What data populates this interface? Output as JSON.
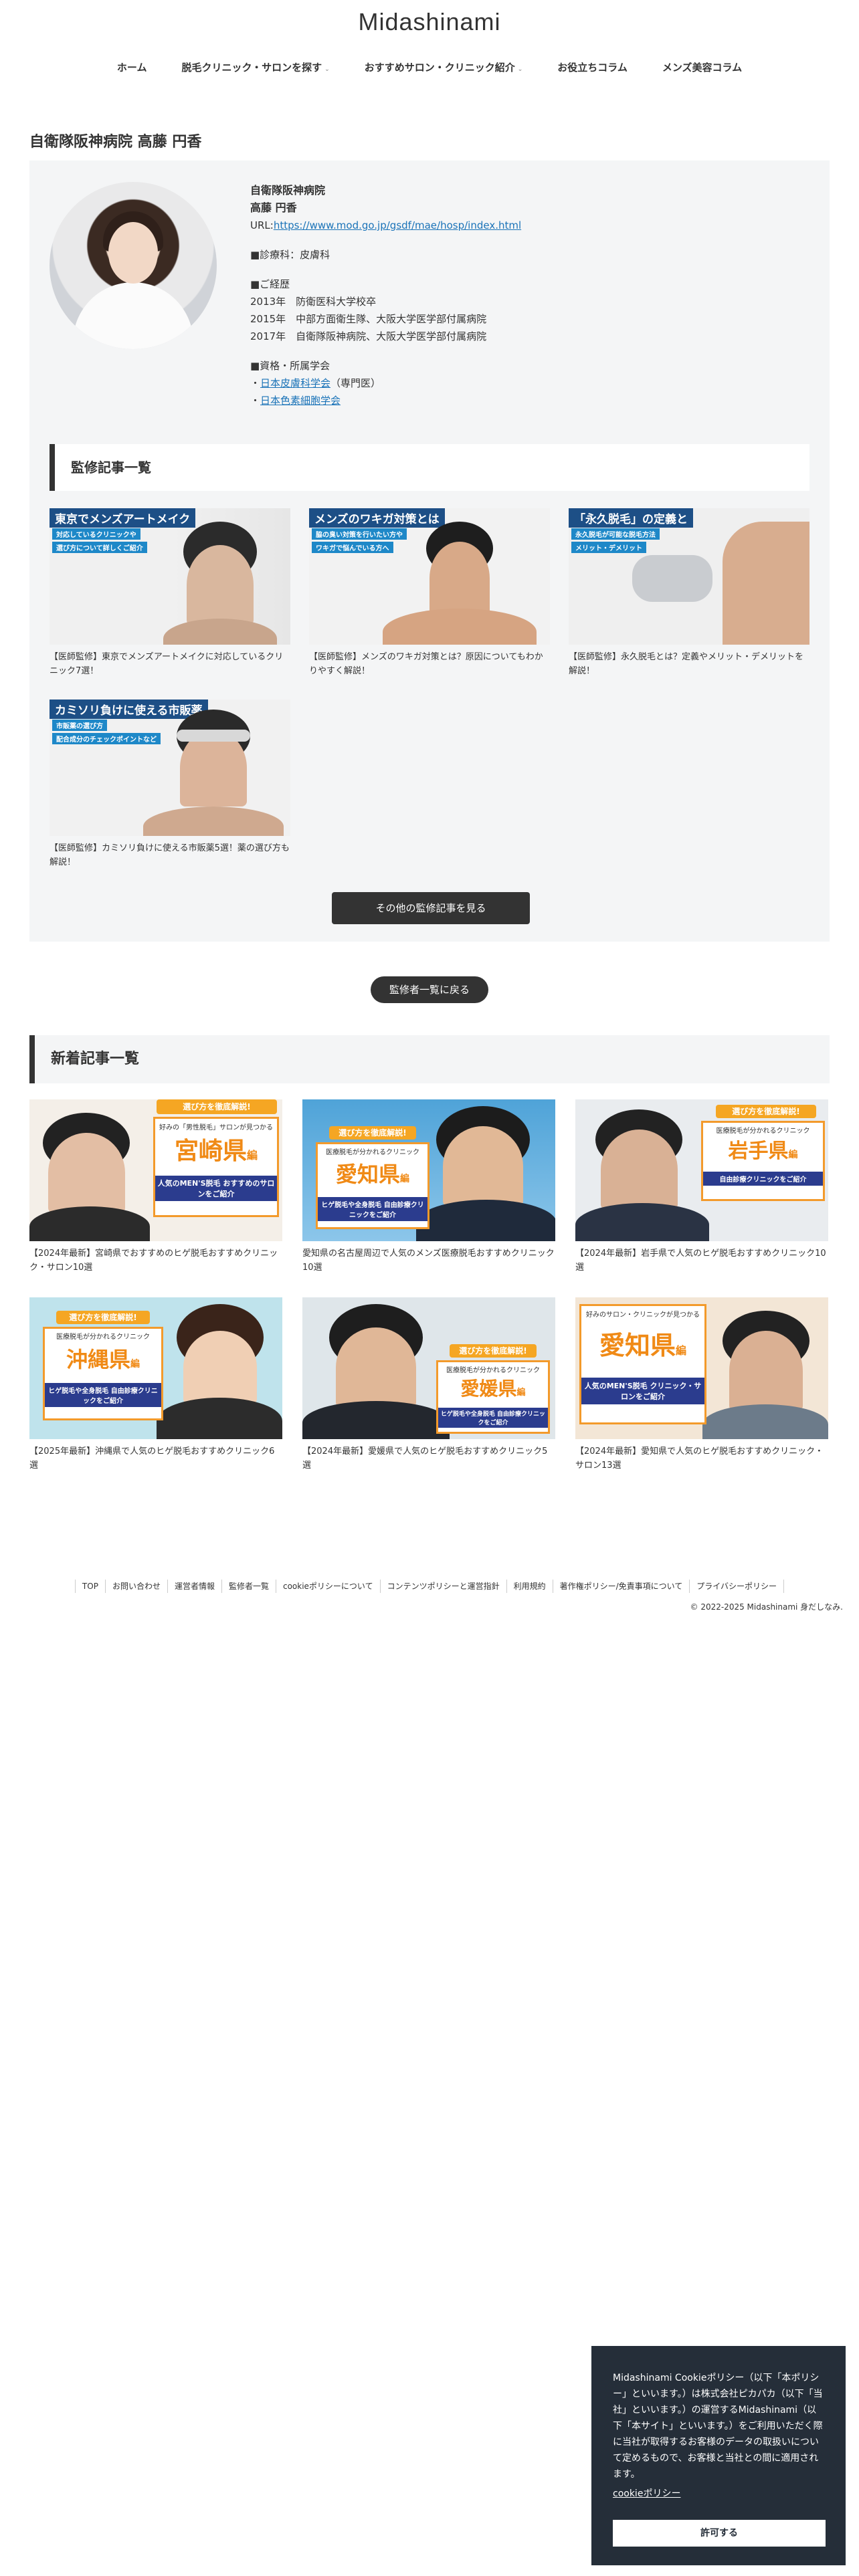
{
  "site": {
    "title": "Midashinami"
  },
  "nav": [
    {
      "label": "ホーム",
      "caret": ""
    },
    {
      "label": "脱毛クリニック・サロンを探す",
      "caret": "⌄"
    },
    {
      "label": "おすすめサロン・クリニック紹介",
      "caret": "⌄"
    },
    {
      "label": "お役立ちコラム",
      "caret": ""
    },
    {
      "label": "メンズ美容コラム",
      "caret": ""
    }
  ],
  "doctor": {
    "heading": "自衛隊阪神病院 高藤 円香",
    "hospital": "自衛隊阪神病院",
    "name": "高藤 円香",
    "url_label": "URL:",
    "url": "https://www.mod.go.jp/gsdf/mae/hosp/index.html",
    "department": "■診療科：皮膚科",
    "career_title": "■ご経歴",
    "career": [
      "2013年　防衛医科大学校卒",
      "2015年　中部方面衛生隊、大阪大学医学部付属病院",
      "2017年　自衛隊阪神病院、大阪大学医学部付属病院"
    ],
    "qual_title": "■資格・所属学会",
    "qual_bullet": "・",
    "qual_1_link": "日本皮膚科学会",
    "qual_1_suffix": "（専門医）",
    "qual_2_link": "日本色素細胞学会"
  },
  "supervised": {
    "heading": "監修記事一覧",
    "articles": [
      {
        "caption": "【医師監修】東京でメンズアートメイクに対応しているクリニック7選！",
        "banner": "東京でメンズアートメイク",
        "tag1": "対応しているクリニックや",
        "tag2": "選び方について詳しくご紹介"
      },
      {
        "caption": "【医師監修】メンズのワキガ対策とは？原因についてもわかりやすく解説！",
        "banner": "メンズのワキガ対策とは",
        "tag1": "脇の臭い対策を行いたい方や",
        "tag2": "ワキガで悩んでいる方へ"
      },
      {
        "caption": "【医師監修】永久脱毛とは？定義やメリット・デメリットを解説！",
        "banner": "「永久脱毛」の定義と",
        "tag1": "永久脱毛が可能な脱毛方法",
        "tag2": "メリット・デメリット"
      },
      {
        "caption": "【医師監修】カミソリ負けに使える市販薬5選！薬の選び方も解説！",
        "banner": "カミソリ負けに使える市販薬",
        "tag1": "市販薬の選び方",
        "tag2": "配合成分のチェックポイントなど"
      }
    ],
    "more_button": "その他の監修記事を見る"
  },
  "back_button": "監修者一覧に戻る",
  "new_articles": {
    "heading": "新着記事一覧",
    "items": [
      {
        "caption": "【2024年最新】宮崎県でおすすめのヒゲ脱毛おすすめクリニック・サロン10選",
        "pref": "宮崎県",
        "pref_suffix": "編",
        "ribbon": "選び方を徹底解説!",
        "sub1": "好みの「男性脱毛」サロンが見つかる",
        "sub2": "人気のMEN'S脱毛 おすすめのサロンをご紹介"
      },
      {
        "caption": "愛知県の名古屋周辺で人気のメンズ医療脱毛おすすめクリニック10選",
        "pref": "愛知県",
        "pref_suffix": "編",
        "ribbon": "選び方を徹底解説!",
        "sub1": "医療脱毛が分かれるクリニック",
        "sub2": "ヒゲ脱毛や全身脱毛 自由診療クリニックをご紹介"
      },
      {
        "caption": "【2024年最新】岩手県で人気のヒゲ脱毛おすすめクリニック10選",
        "pref": "岩手県",
        "pref_suffix": "編",
        "ribbon": "選び方を徹底解説!",
        "sub1": "医療脱毛が分かれるクリニック",
        "sub2": "自由診療クリニックをご紹介"
      },
      {
        "caption": "【2025年最新】沖縄県で人気のヒゲ脱毛おすすめクリニック6選",
        "pref": "沖縄県",
        "pref_suffix": "編",
        "ribbon": "選び方を徹底解説!",
        "sub1": "医療脱毛が分かれるクリニック",
        "sub2": "ヒゲ脱毛や全身脱毛 自由診療クリニックをご紹介"
      },
      {
        "caption": "【2024年最新】愛媛県で人気のヒゲ脱毛おすすめクリニック5選",
        "pref": "愛媛県",
        "pref_suffix": "編",
        "ribbon": "選び方を徹底解説!",
        "sub1": "医療脱毛が分かれるクリニック",
        "sub2": "ヒゲ脱毛や全身脱毛 自由診療クリニックをご紹介"
      },
      {
        "caption": "【2024年最新】愛知県で人気のヒゲ脱毛おすすめクリニック・サロン13選",
        "pref": "愛知県",
        "pref_suffix": "編",
        "ribbon": "",
        "sub1": "好みのサロン・クリニックが見つかる",
        "sub2": "人気のMEN'S脱毛 クリニック・サロンをご紹介"
      }
    ]
  },
  "footer": {
    "links": [
      "TOP",
      "お問い合わせ",
      "運営者情報",
      "監修者一覧",
      "cookieポリシーについて",
      "コンテンツポリシーと運営指針",
      "利用規約",
      "著作権ポリシー/免責事項について",
      "プライバシーポリシー"
    ],
    "copyright": "© 2022-2025 Midashinami 身だしなみ."
  },
  "cookie": {
    "message": "Midashinami Cookieポリシー（以下「本ポリシー」といいます。）は株式会社ピカパカ（以下「当社」といいます。）の運営するMidashinami（以下「本サイト」といいます。）をご利用いただく際に当社が取得するお客様のデータの取扱いについて定めるもので、お客様と当社との間に適用されます。",
    "policy_link": "cookieポリシー",
    "accept": "許可する"
  },
  "colors": {
    "accent_dark": "#333333",
    "panel_bg": "#f4f5f6",
    "link": "#1a73b8",
    "cookie_bg": "#252e39",
    "pref_orange": "#f08a16"
  }
}
